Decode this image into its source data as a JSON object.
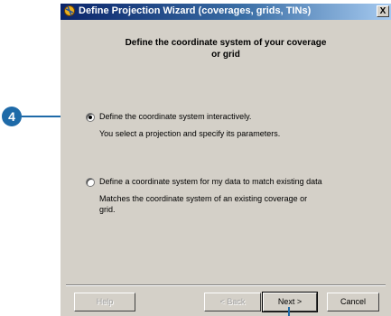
{
  "window": {
    "title": "Define Projection Wizard (coverages, grids, TINs)",
    "close_glyph": "X"
  },
  "heading": {
    "line1": "Define the coordinate system of your coverage",
    "line2": "or grid"
  },
  "options": [
    {
      "label": "Define the coordinate system interactively.",
      "desc": "You select a projection and specify its parameters.",
      "selected": true
    },
    {
      "label": "Define a coordinate system for my data to match existing data",
      "desc1": "Matches the coordinate system of an existing coverage or",
      "desc2": "grid.",
      "selected": false
    }
  ],
  "buttons": {
    "help": "Help",
    "back": "< Back",
    "next": "Next >",
    "cancel": "Cancel"
  },
  "callout": {
    "number": "4"
  },
  "colors": {
    "callout": "#1e6aa8",
    "dialog_bg": "#d4d0c8"
  }
}
